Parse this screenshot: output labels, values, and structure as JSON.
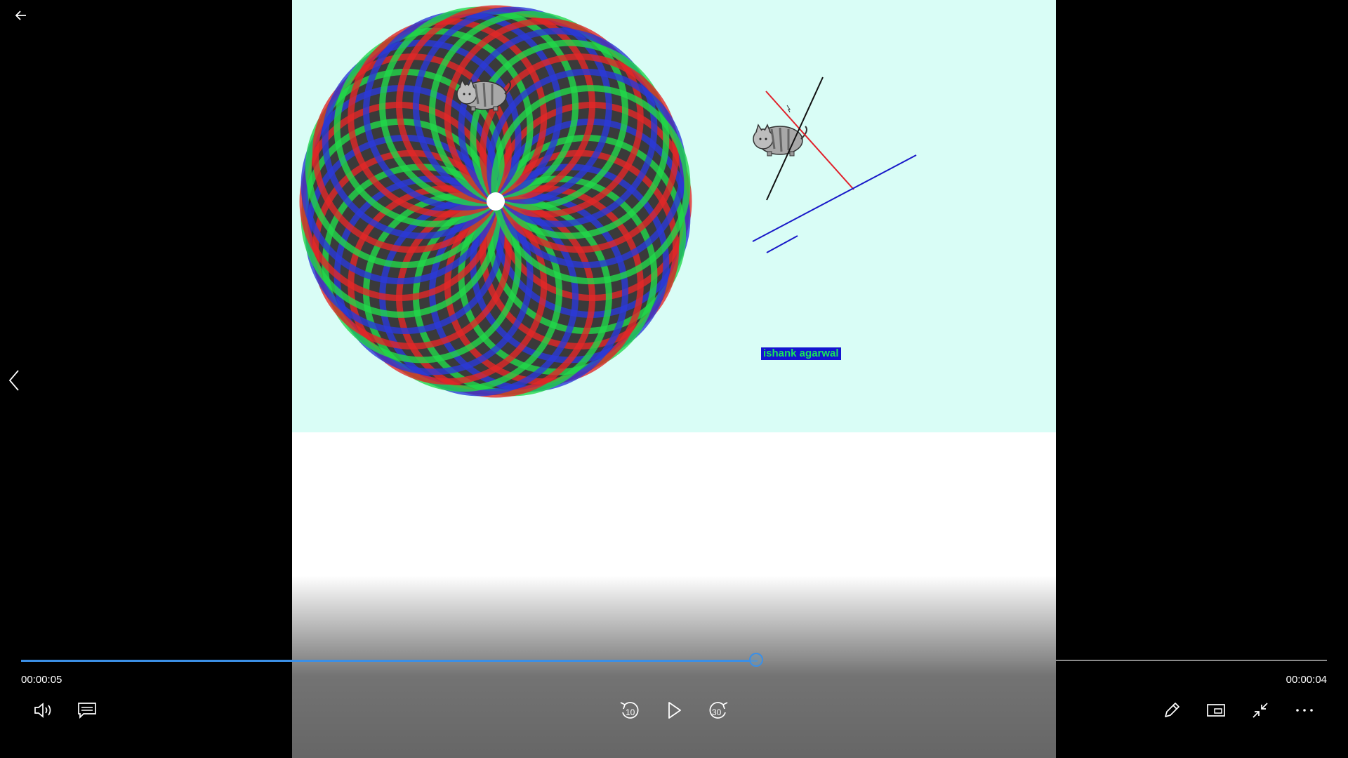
{
  "window": {
    "app": "Video player"
  },
  "video": {
    "credit_text": "ishank agarwal"
  },
  "player": {
    "elapsed_time": "00:00:05",
    "remaining_time": "00:00:04",
    "progress_fraction": 0.564,
    "skip_back_seconds": "10",
    "skip_forward_seconds": "30",
    "accent_color": "#3b8fe6"
  },
  "controls": {
    "left": [
      "volume-icon",
      "subtitles-icon"
    ],
    "center": [
      "skip-back-10-icon",
      "play-icon",
      "skip-forward-30-icon"
    ],
    "right": [
      "edit-pencil-icon",
      "mini-view-icon",
      "exit-fullscreen-icon",
      "more-options-icon"
    ]
  },
  "navigation": {
    "back": "back-arrow-icon",
    "previous": "chevron-left-icon"
  }
}
